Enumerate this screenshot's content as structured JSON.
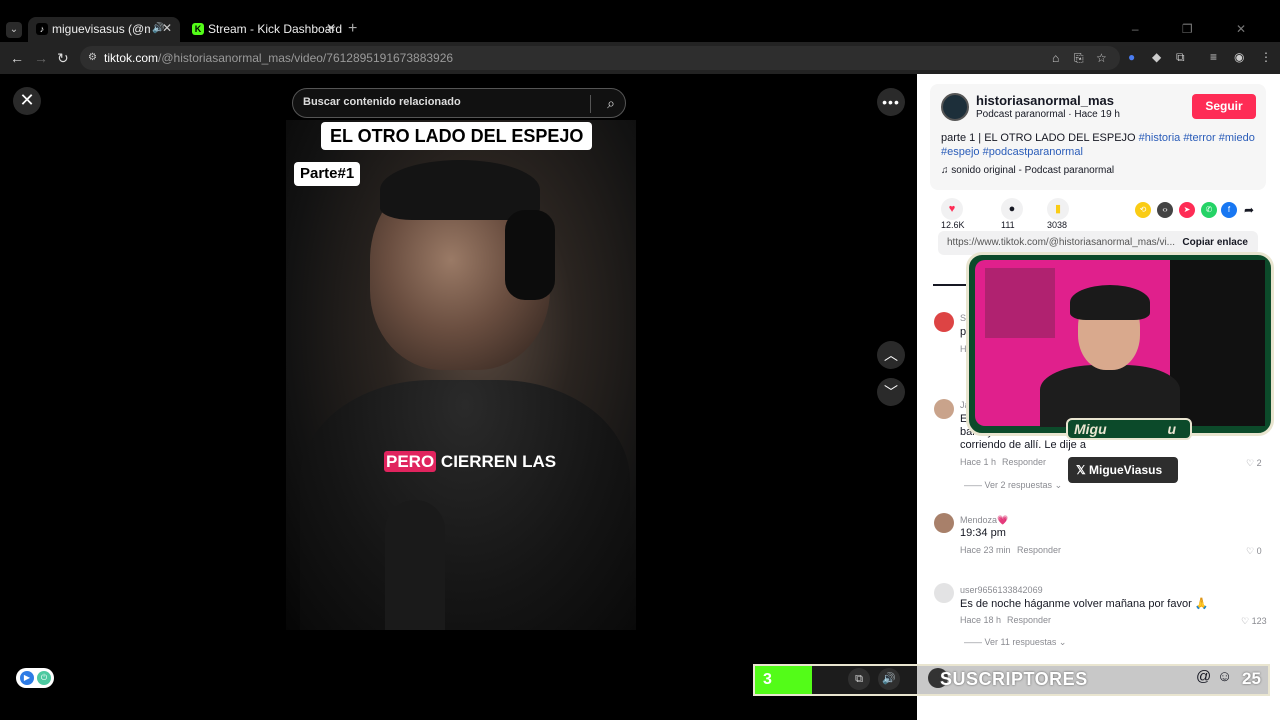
{
  "browser": {
    "tabs": [
      {
        "title": "miguevisasus (@miguevisasus)",
        "active": true
      },
      {
        "title": "Stream - Kick Dashboard",
        "active": false
      }
    ],
    "url_host": "tiktok.com",
    "url_path": "/@historiasanormal_mas/video/7612895191673883926"
  },
  "video": {
    "search_placeholder": "Buscar contenido relacionado",
    "title_overlay": "EL OTRO LADO DEL ESPEJO",
    "part_overlay": "Parte#1",
    "caption_highlight": "PERO",
    "caption_rest": " CIERREN LAS"
  },
  "post": {
    "username": "historiasanormal_mas",
    "subline": "Podcast paranormal · Hace 19 h",
    "follow_label": "Seguir",
    "desc_text": "parte 1 | EL OTRO LADO DEL ESPEJO ",
    "tags": [
      "#historia",
      "#terror",
      "#miedo",
      "#espejo",
      "#podcastparanormal"
    ],
    "music": "sonido original - Podcast paranormal",
    "likes": "12.6K",
    "comments": "111",
    "saves": "3038",
    "link": "https://www.tiktok.com/@historiasanormal_mas/vi...",
    "copy_label": "Copiar enlace"
  },
  "comments": [
    {
      "name": "Se",
      "text": "pe",
      "meta": "Ha",
      "like": ""
    },
    {
      "name": "Ja",
      "text_line1": "Es",
      "text_line2": "baño y se ...",
      "text_line3": "corriendo de allí. Le dije a",
      "meta": "Hace 1 h",
      "reply": "Responder",
      "like": "2",
      "more": "Ver 2 respuestas"
    },
    {
      "name": "Mendoza💗",
      "text": "19:34 pm",
      "meta": "Hace 23 min",
      "reply": "Responder",
      "like": "0"
    },
    {
      "name": "user9656133842069",
      "text": "Es de noche háganme volver mañana por favor 🙏",
      "meta": "Hace 18 h",
      "reply": "Responder",
      "like": "123",
      "more": "Ver 11 respuestas"
    }
  ],
  "overlay": {
    "cam_label": "Migu",
    "cam_label_tail": "u",
    "x_handle": "MigueViasus",
    "sub_count": "3",
    "sub_label": "SUSCRIPTORES",
    "sub_goal": "25"
  }
}
